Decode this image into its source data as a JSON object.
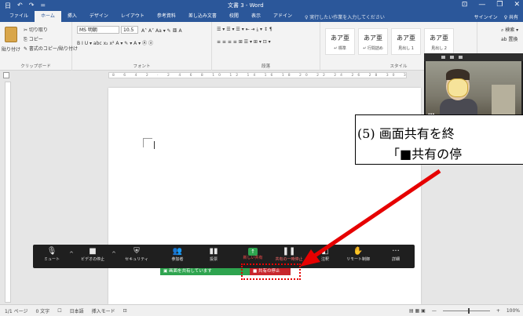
{
  "titlebar": {
    "qat": [
      "日",
      "↶",
      "↷",
      "="
    ],
    "doc_title": "文書 3 - Word",
    "win_buttons": [
      "⊡",
      "—",
      "❐",
      "✕"
    ]
  },
  "tabs": {
    "items": [
      "ファイル",
      "ホーム",
      "挿入",
      "デザイン",
      "レイアウト",
      "参考資料",
      "差し込み文書",
      "校閲",
      "表示",
      "アドイン"
    ],
    "active_index": 1,
    "tell_me": "♀ 実行したい作業を入力してください",
    "signin": "サインイン",
    "share": "♀ 共有"
  },
  "ribbon": {
    "clipboard": {
      "paste": "貼り付け",
      "cut": "✂ 切り取り",
      "copy": "⎘ コピー",
      "format_painter": "✎ 書式のコピー/貼り付け",
      "label": "クリップボード"
    },
    "font": {
      "name": "MS 明朝",
      "size": "10.5",
      "grow_shrink": "A˄ A˅  Aa ▾  ✎ 亜 A",
      "format_row": "B I U ▾ abc x₂ x²  A ▾ ✎ ▾ A ▾ Ⓐ ⓐ",
      "label": "フォント"
    },
    "paragraph": {
      "row1": "☰ ▾ ☰ ▾ ☰ ▾  ⇤ ⇥  ⤓ ▾  ↕  ¶",
      "row2": "≡ ≡ ≡ ≡ ⊞  ☰ ▾  ⊞ ▾ ⊡ ▾",
      "label": "段落"
    },
    "styles": {
      "items": [
        {
          "sample": "あア亜",
          "name": "↵ 標準"
        },
        {
          "sample": "あア亜",
          "name": "↵ 行間詰め"
        },
        {
          "sample": "あア亜",
          "name": "見出し 1"
        },
        {
          "sample": "あア亜",
          "name": "見出し 2"
        }
      ],
      "label": "スタイル"
    },
    "editing": {
      "find": "⌕ 検索 ▾",
      "replace": "ab 置換"
    }
  },
  "ruler": {
    "marks": "8 6 4 2 · 2 4 6 8 10 12 14 16 18 20 22 24 26 28 30 32 34 36 38 40 42 44 46 48"
  },
  "statusbar": {
    "page": "1/1 ページ",
    "words": "0 文字",
    "proof_icon": "☐",
    "language": "日本語",
    "input_mode": "挿入モード",
    "macro_icon": "⊡",
    "view_icons": "▤ ▦ ▣",
    "zoom_minus": "—",
    "zoom_plus": "+",
    "zoom": "100%"
  },
  "video": {
    "name": "▮▮▮"
  },
  "callout": {
    "line1": "(5) 画面共有を終",
    "line2": "「■共有の停"
  },
  "zoombar": {
    "buttons": [
      {
        "icon": "🎙",
        "label": "ミュート"
      },
      {
        "icon": "■",
        "label": "ビデオの停止"
      },
      {
        "icon": "⛨",
        "label": "セキュリティ"
      },
      {
        "icon": "👥",
        "label": "参加者"
      },
      {
        "icon": "▮▮",
        "label": "投票"
      },
      {
        "icon": "↑",
        "label": "新しい共有"
      },
      {
        "icon": "❚❚",
        "label": "共有の一時停止"
      },
      {
        "icon": "◧",
        "label": "注釈"
      },
      {
        "icon": "✋",
        "label": "リモート制御"
      },
      {
        "icon": "···",
        "label": "詳細"
      }
    ],
    "caret": "^"
  },
  "sharing": {
    "text": "▣ 画面を共有しています",
    "stop": "■ 共有の停止"
  },
  "colors": {
    "word_blue": "#2b579a",
    "zoom_green": "#2ea44f",
    "stop_red": "#c8262c",
    "arrow_red": "#e60000"
  }
}
